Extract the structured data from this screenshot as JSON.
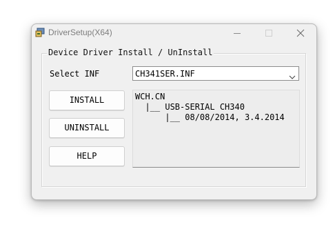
{
  "window": {
    "title": "DriverSetup(X64)",
    "controls": {
      "minimize": "minimize-icon",
      "maximize": "maximize-icon",
      "close": "close-icon"
    }
  },
  "group": {
    "label": "Device Driver Install / UnInstall"
  },
  "select_inf": {
    "label": "Select INF",
    "value": "CH341SER.INF"
  },
  "buttons": {
    "install": "INSTALL",
    "uninstall": "UNINSTALL",
    "help": "HELP"
  },
  "info": {
    "lines": [
      "WCH.CN",
      "  |__ USB-SERIAL CH340",
      "      |__ 08/08/2014, 3.4.2014"
    ]
  },
  "colors": {
    "window_bg": "#f0f0f0",
    "title_text": "#7d7d7d",
    "button_bg": "#fdfdfd",
    "panel_bg": "#ededed"
  }
}
